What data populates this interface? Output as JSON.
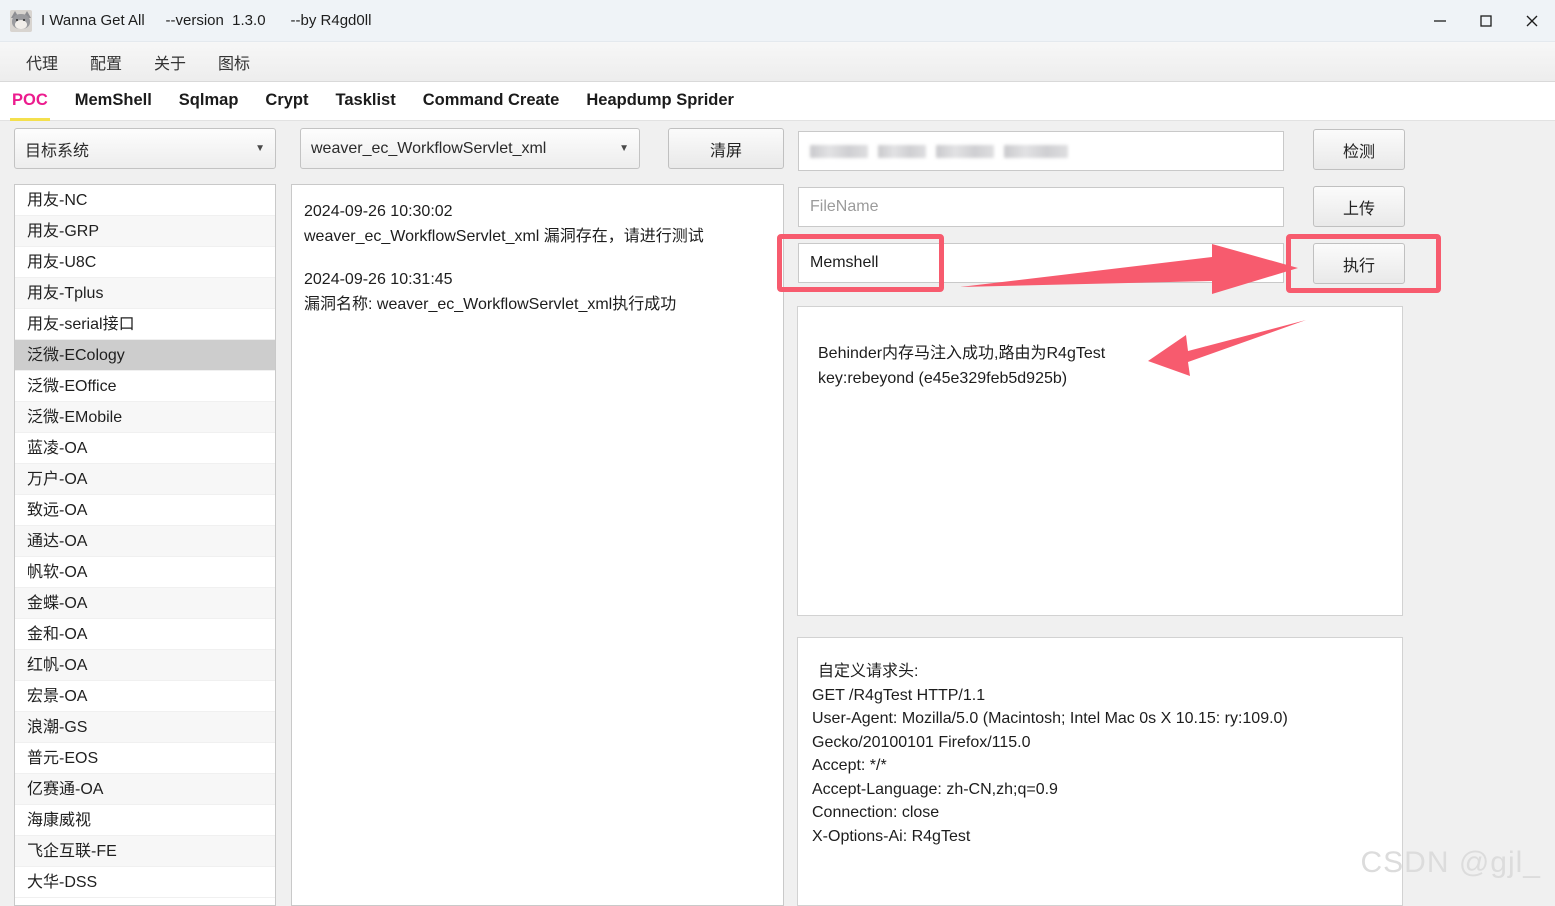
{
  "window": {
    "title": "I Wanna Get All     --version  1.3.0      --by R4gd0ll",
    "app_icon": "cat-icon",
    "controls": {
      "minimize": "minimize-icon",
      "maximize": "maximize-icon",
      "close": "close-icon"
    }
  },
  "menubar": {
    "items": [
      {
        "label": "代理"
      },
      {
        "label": "配置"
      },
      {
        "label": "关于"
      },
      {
        "label": "图标"
      }
    ]
  },
  "tabs": {
    "active": "POC",
    "items": [
      {
        "label": "POC"
      },
      {
        "label": "MemShell"
      },
      {
        "label": "Sqlmap"
      },
      {
        "label": "Crypt"
      },
      {
        "label": "Tasklist"
      },
      {
        "label": "Command Create"
      },
      {
        "label": "Heapdump Sprider"
      }
    ]
  },
  "toolbar": {
    "target_system": {
      "value": "目标系统",
      "caret": "chevron-down-icon"
    },
    "poc_select": {
      "value": "weaver_ec_WorkflowServlet_xml",
      "caret": "chevron-down-icon"
    },
    "clear_button": "清屏"
  },
  "sidebar": {
    "selected": "泛微-ECology",
    "items": [
      {
        "label": "用友-NC"
      },
      {
        "label": "用友-GRP"
      },
      {
        "label": "用友-U8C"
      },
      {
        "label": "用友-Tplus"
      },
      {
        "label": "用友-serial接口"
      },
      {
        "label": "泛微-ECology"
      },
      {
        "label": "泛微-EOffice"
      },
      {
        "label": "泛微-EMobile"
      },
      {
        "label": "蓝凌-OA"
      },
      {
        "label": "万户-OA"
      },
      {
        "label": "致远-OA"
      },
      {
        "label": "通达-OA"
      },
      {
        "label": "帆软-OA"
      },
      {
        "label": "金蝶-OA"
      },
      {
        "label": "金和-OA"
      },
      {
        "label": "红帆-OA"
      },
      {
        "label": "宏景-OA"
      },
      {
        "label": "浪潮-GS"
      },
      {
        "label": "普元-EOS"
      },
      {
        "label": "亿赛通-OA"
      },
      {
        "label": "海康威视"
      },
      {
        "label": "飞企互联-FE"
      },
      {
        "label": "大华-DSS"
      }
    ]
  },
  "log": {
    "entry1_time": "2024-09-26 10:30:02",
    "entry1_text": "weaver_ec_WorkflowServlet_xml 漏洞存在，请进行测试",
    "entry2_time": "2024-09-26 10:31:45",
    "entry2_text": "漏洞名称: weaver_ec_WorkflowServlet_xml执行成功"
  },
  "right": {
    "url_input": {
      "value": "",
      "redacted": true
    },
    "filename_input": {
      "value": "",
      "placeholder": "FileName"
    },
    "command_input": {
      "value": "Memshell"
    },
    "detect_button": "检测",
    "upload_button": "上传",
    "execute_button": "执行",
    "result": {
      "line1": "Behinder内存马注入成功,路由为R4gTest",
      "line2": "key:rebeyond (e45e329feb5d925b)"
    },
    "headers": {
      "title": "自定义请求头:",
      "lines": [
        "GET /R4gTest HTTP/1.1",
        "User-Agent: Mozilla/5.0 (Macintosh; Intel Mac 0s X 10.15: ry:109.0)",
        "Gecko/20100101 Firefox/115.0",
        "Accept: */*",
        "Accept-Language: zh-CN,zh;q=0.9",
        "Connection: close",
        "X-Options-Ai: R4gTest"
      ]
    }
  },
  "annotations": {
    "color": "#f75b6e",
    "arrow_right": "arrow-right-icon",
    "arrow_left": "arrow-left-icon",
    "box_command": "highlight-box",
    "box_execute": "highlight-box"
  },
  "watermark": {
    "text": "CSDN @gjl_"
  }
}
